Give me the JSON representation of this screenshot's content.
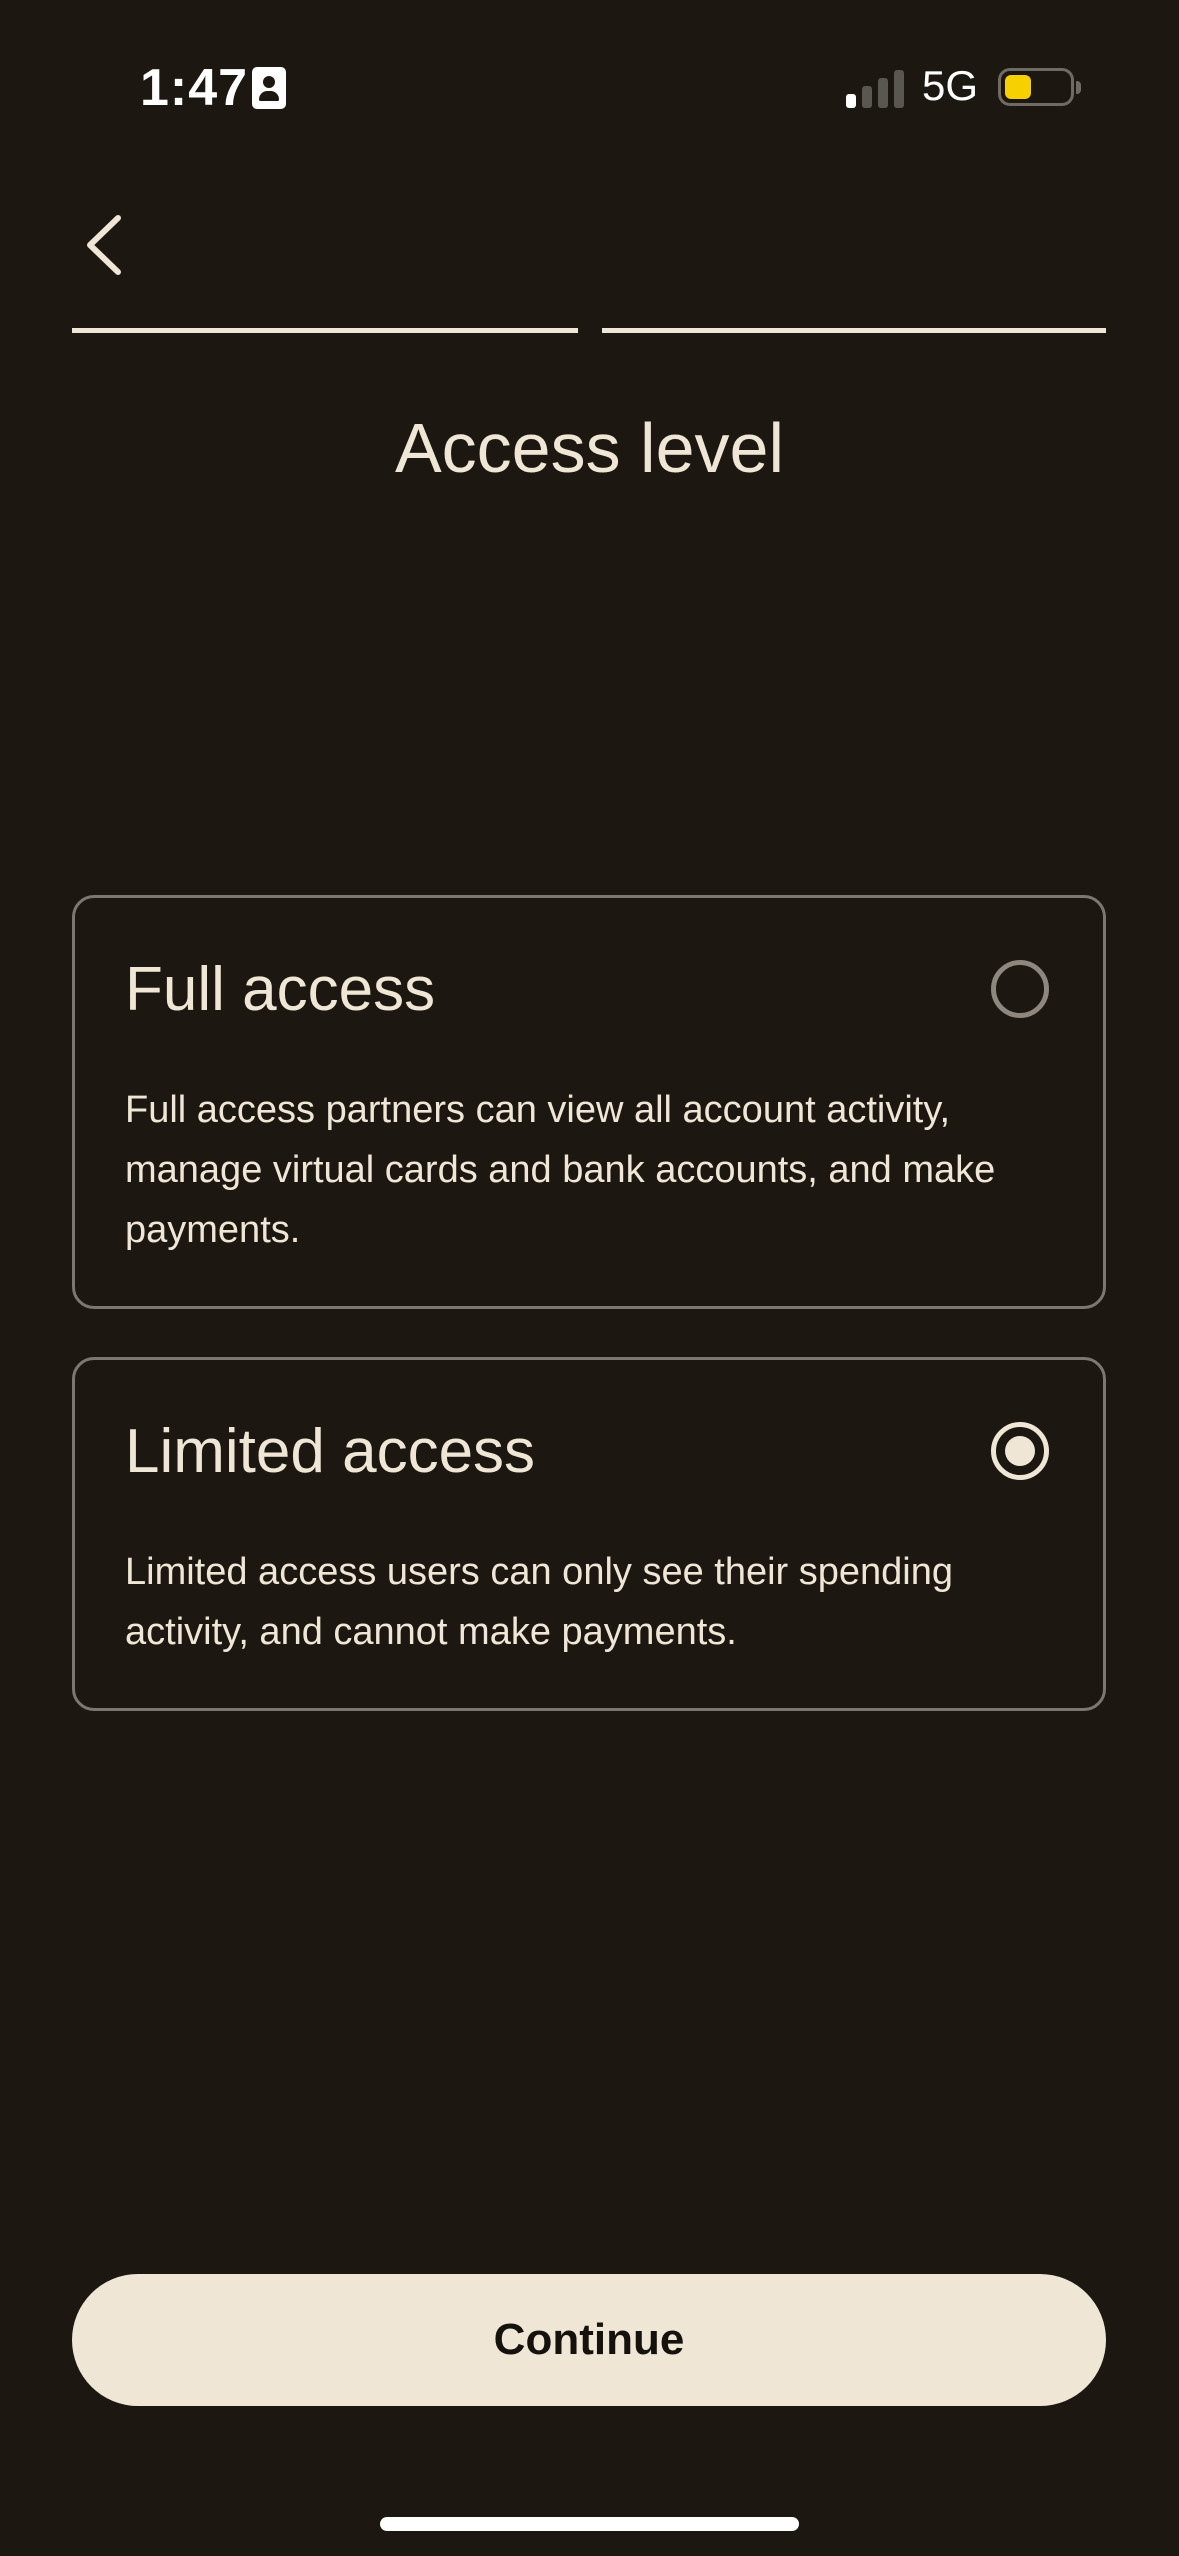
{
  "status_bar": {
    "time": "1:47",
    "network": "5G",
    "battery_color": "#f7d000"
  },
  "header": {
    "back_icon": "chevron-left-icon",
    "title": "Access level",
    "progress_steps": 2
  },
  "options": [
    {
      "title": "Full access",
      "description": "Full access partners can view all account activity, manage virtual cards and bank accounts, and make payments.",
      "selected": false
    },
    {
      "title": "Limited access",
      "description": "Limited access users can only see their spending activity, and cannot make payments.",
      "selected": true
    }
  ],
  "footer": {
    "continue_label": "Continue"
  },
  "colors": {
    "background": "#1c1811",
    "accent": "#efe6d6"
  }
}
